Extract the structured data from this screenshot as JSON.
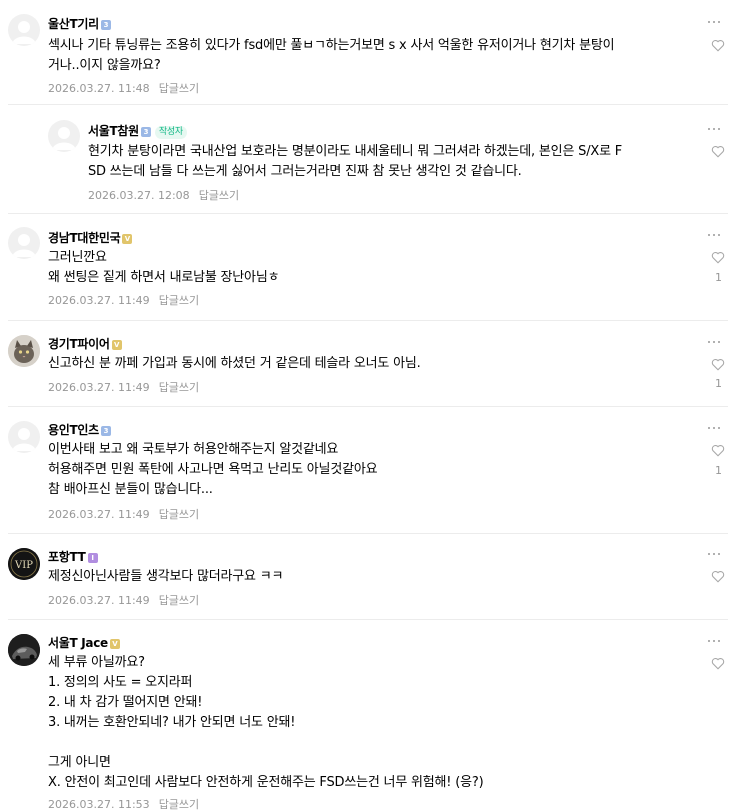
{
  "reply_label": "답글쓰기",
  "comments": [
    {
      "author": "울산T기리",
      "level": "3",
      "lines": [
        "섹시나 기타 튜닝류는 조용히 있다가 fsd에만 풀ㅂㄱ하는거보면 s x 사서 억울한 유저이거나 현기차 분탕이",
        "거나..이지 않을까요?"
      ],
      "date": "2026.03.27. 11:48",
      "likes": ""
    },
    {
      "author": "서울T참원",
      "level": "3",
      "badge": "작성자",
      "lines": [
        "현기차 분탕이라면 국내산업 보호라는 명분이라도 내세울테니 뭐 그러셔라 하겠는데, 본인은 S/X로 F",
        "SD 쓰는데 남들 다 쓰는게 싫어서 그러는거라면 진짜 참 못난 생각인 것 같습니다."
      ],
      "date": "2026.03.27. 12:08",
      "likes": ""
    },
    {
      "author": "경남T대한민국",
      "level": "V",
      "lines": [
        "그러닌깐요",
        "왜 썬팅은 짙게 하면서 내로남불 장난아님ㅎ"
      ],
      "date": "2026.03.27. 11:49",
      "likes": "1"
    },
    {
      "author": "경기T파이어",
      "level": "V",
      "lines": [
        "신고하신 분 까페 가입과 동시에 하셨던 거 같은데 테슬라 오너도 아님."
      ],
      "date": "2026.03.27. 11:49",
      "likes": "1"
    },
    {
      "author": "용인T인츠",
      "level": "3",
      "lines": [
        "이번사태 보고 왜 국토부가 허용안해주는지 알것같네요",
        "허용해주면 민원 폭탄에 사고나면 욕먹고 난리도 아닐것같아요",
        "참 배아프신 분들이 많습니다..."
      ],
      "date": "2026.03.27. 11:49",
      "likes": "1"
    },
    {
      "author": "포항TT",
      "level": "I",
      "avatar_text": "VIP",
      "lines": [
        "제정신아닌사람들 생각보다 많더라구요 ㅋㅋ"
      ],
      "date": "2026.03.27. 11:49",
      "likes": ""
    },
    {
      "author": "서울T Jace",
      "level": "V",
      "lines": [
        "세 부류 아닐까요?",
        "1. 정의의 사도 = 오지라퍼",
        "2. 내 차 감가 떨어지면 안돼!",
        "3. 내꺼는 호환안되네? 내가 안되면 너도 안돼!",
        "",
        "그게 아니면",
        "X. 안전이 최고인데 사람보다 안전하게 운전해주는 FSD쓰는건 너무 위험해! (응?)"
      ],
      "date": "2026.03.27. 11:53",
      "likes": ""
    }
  ],
  "colors": {
    "badge_green": "#12b886",
    "meta_gray": "#979797"
  },
  "icons": [
    "more-options-icon",
    "heart-icon",
    "default-avatar-icon"
  ]
}
